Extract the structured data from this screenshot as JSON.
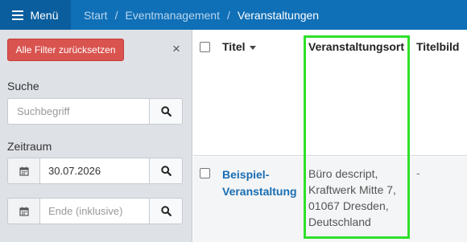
{
  "topbar": {
    "menu_label": "Menü",
    "breadcrumb": [
      "Start",
      "Eventmanagement",
      "Veranstaltungen"
    ],
    "separator": "/"
  },
  "sidebar": {
    "reset_label": "Alle Filter zurücksetzen",
    "close_icon": "×",
    "search": {
      "label": "Suche",
      "placeholder": "Suchbegriff"
    },
    "timerange": {
      "label": "Zeitraum",
      "start_value": "30.07.2026",
      "end_placeholder": "Ende (inklusive)"
    }
  },
  "table": {
    "columns": [
      "Titel",
      "Veranstaltungsort",
      "Titelbild"
    ],
    "rows": [
      {
        "title_line1": "Beispiel-",
        "title_line2": "Veranstaltung",
        "ort_lines": [
          "Büro descript,",
          "Kraftwerk Mitte 7,",
          "01067 Dresden,",
          "Deutschland"
        ],
        "titelbild": "-"
      }
    ]
  },
  "colors": {
    "topbar": "#0f6fb7",
    "reset_button": "#d9534f",
    "link": "#1a6db3",
    "highlight": "#2fe02a"
  }
}
